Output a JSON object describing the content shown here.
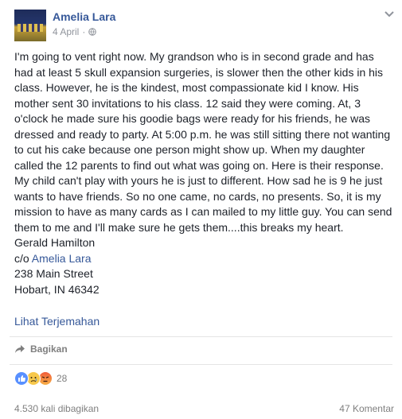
{
  "post": {
    "author": "Amelia Lara",
    "date": "4 April",
    "separator": "·",
    "body_before_mention": "I'm going to vent right now. My grandson who is in second grade and has had at least 5 skull expansion surgeries, is slower then the other kids in his class. However, he is the kindest, most compassionate kid I know. His mother sent 30 invitations to his class. 12 said they were coming. At, 3 o'clock he made sure his goodie bags were ready for his friends, he was dressed and ready to party. At 5:00 p.m. he was still sitting there not wanting to cut his cake because one person might show up. When my daughter called the 12 parents to find out what was going on. Here is their response. My child can't play with yours he is just to different. How sad he is 9 he just wants to have friends. So no one came, no cards, no presents. So, it is my mission to have as many cards as I can mailed to my little guy. You can send them to me and I'll make sure he gets them....this breaks my heart.\nGerald Hamilton\nc/o ",
    "mention": "Amelia Lara",
    "body_after_mention": "\n238 Main Street\nHobart, IN 46342",
    "translate_link": "Lihat Terjemahan"
  },
  "actions": {
    "share_label": "Bagikan"
  },
  "reactions": {
    "count": "28",
    "icons": [
      "like-icon",
      "sad-icon",
      "angry-icon"
    ]
  },
  "footer": {
    "shares": "4.530 kali dibagikan",
    "comments": "47 Komentar"
  },
  "colors": {
    "link": "#365899",
    "muted": "#90949c",
    "text": "#1d2129"
  }
}
